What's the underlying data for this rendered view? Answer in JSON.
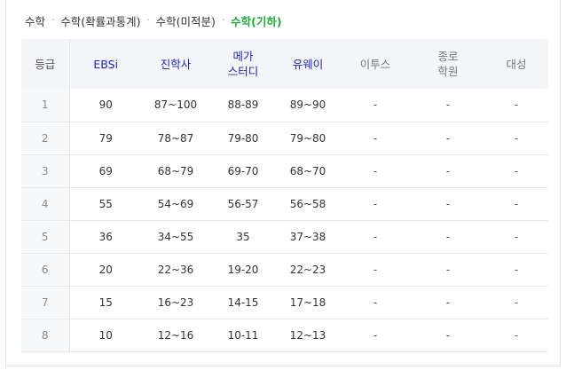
{
  "tabs": [
    {
      "label": "수학",
      "active": false
    },
    {
      "label": "수학(확률과통계)",
      "active": false
    },
    {
      "label": "수학(미적분)",
      "active": false
    },
    {
      "label": "수학(기하)",
      "active": true
    }
  ],
  "separator": "·",
  "table": {
    "headers": [
      {
        "lines": [
          "등급"
        ]
      },
      {
        "lines": [
          "EBSi"
        ]
      },
      {
        "lines": [
          "진학사"
        ]
      },
      {
        "lines": [
          "메가",
          "스터디"
        ]
      },
      {
        "lines": [
          "유웨이"
        ]
      },
      {
        "lines": [
          "이투스"
        ]
      },
      {
        "lines": [
          "종로",
          "학원"
        ]
      },
      {
        "lines": [
          "대성"
        ]
      }
    ],
    "rows": [
      [
        "1",
        "90",
        "87~100",
        "88-89",
        "89~90",
        "-",
        "-",
        "-"
      ],
      [
        "2",
        "79",
        "78~87",
        "79-80",
        "79~80",
        "-",
        "-",
        "-"
      ],
      [
        "3",
        "69",
        "68~79",
        "69-70",
        "68~70",
        "-",
        "-",
        "-"
      ],
      [
        "4",
        "55",
        "54~69",
        "56-57",
        "56~58",
        "-",
        "-",
        "-"
      ],
      [
        "5",
        "36",
        "34~55",
        "35",
        "37~38",
        "-",
        "-",
        "-"
      ],
      [
        "6",
        "20",
        "22~36",
        "19-20",
        "22~23",
        "-",
        "-",
        "-"
      ],
      [
        "7",
        "15",
        "16~23",
        "14-15",
        "17~18",
        "-",
        "-",
        "-"
      ],
      [
        "8",
        "10",
        "12~16",
        "10-11",
        "12~13",
        "-",
        "-",
        "-"
      ]
    ]
  },
  "colors": {
    "active_tab": "#23a83b",
    "provider_blue": "#2127a6",
    "header_bg": "#f3f5f8"
  }
}
